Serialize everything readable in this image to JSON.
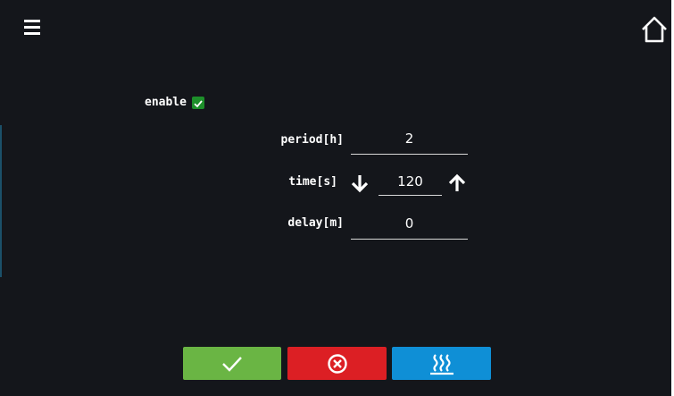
{
  "colors": {
    "background": "#14161b",
    "text": "#ffffff",
    "checkbox_checked": "#1d8f2a",
    "confirm_button": "#6ab544",
    "cancel_button": "#dc1f24",
    "heat_button": "#0f8fd6"
  },
  "header": {
    "menu_icon": "hamburger-menu-icon",
    "home_icon": "home-icon"
  },
  "settings": {
    "enable_label": "enable",
    "enable_checked": true,
    "period_label": "period[h]",
    "period_value": "2",
    "time_label": "time[s]",
    "time_value": "120",
    "time_decrease_icon": "arrow-down-icon",
    "time_increase_icon": "arrow-up-icon",
    "delay_label": "delay[m]",
    "delay_value": "0"
  },
  "actions": {
    "confirm_icon": "checkmark-icon",
    "cancel_icon": "circle-x-icon",
    "heat_icon": "heating-icon"
  }
}
